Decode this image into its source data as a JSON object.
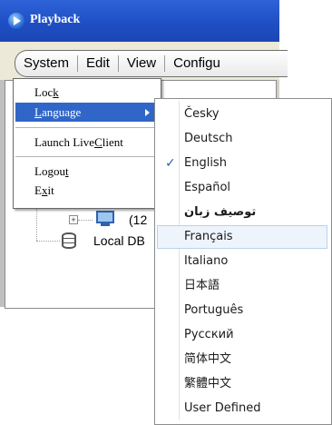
{
  "window": {
    "title": "Playback"
  },
  "menubar": {
    "items": [
      "System",
      "Edit",
      "View",
      "Configu"
    ]
  },
  "tree": {
    "device_label": "(12",
    "db_label": "Local DB"
  },
  "system_menu": {
    "items": [
      {
        "label": "Lock",
        "accel": "k"
      },
      {
        "label": "Language",
        "accel": "L",
        "selected": true,
        "has_submenu": true
      },
      {
        "label": "Launch LiveClient",
        "accel": "C"
      },
      {
        "label": "Logout",
        "accel": "t"
      },
      {
        "label": "Exit",
        "accel": "x"
      }
    ]
  },
  "language_menu": {
    "items": [
      {
        "label": "Česky"
      },
      {
        "label": "Deutsch"
      },
      {
        "label": "English",
        "checked": true
      },
      {
        "label": "Español"
      },
      {
        "label": "توصیف زبان"
      },
      {
        "label": "Français",
        "hovered": true
      },
      {
        "label": "Italiano"
      },
      {
        "label": "日本語"
      },
      {
        "label": "Português"
      },
      {
        "label": "Русский"
      },
      {
        "label": "简体中文"
      },
      {
        "label": "繁體中文"
      },
      {
        "label": "User Defined"
      }
    ],
    "check_mark": "✓"
  },
  "colors": {
    "title_bar": "#2456cf",
    "menu_selection": "#3166c9",
    "hover_highlight": "#eef4fc"
  }
}
